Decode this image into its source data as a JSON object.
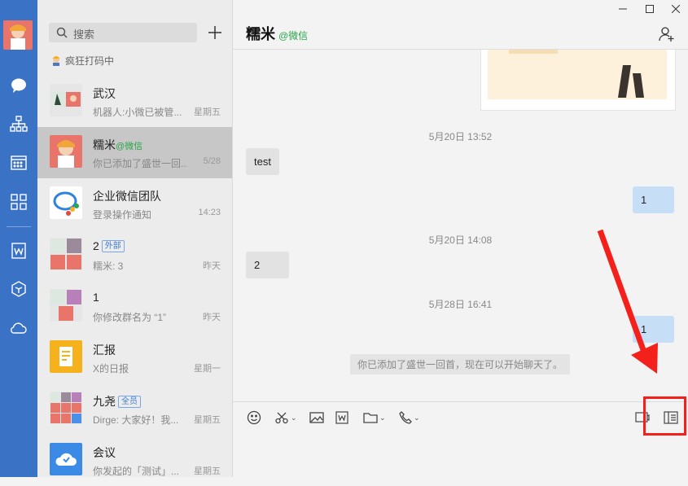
{
  "sidebar_rail": {
    "nav": [
      "chat-icon",
      "org-chart-icon",
      "calendar-icon",
      "apps-grid-icon",
      "doc-icon",
      "cube-icon",
      "cloud-icon"
    ]
  },
  "conversations_panel": {
    "search_label": "搜索",
    "status_text": "疯狂打码中",
    "items": [
      {
        "name": "武汉",
        "tag": "",
        "preview": "机器人:小微已被管...",
        "time": "星期五",
        "selected": false
      },
      {
        "name": "糯米",
        "tag": "@微信",
        "preview": "你已添加了盛世一回...",
        "time": "5/28",
        "selected": true
      },
      {
        "name": "企业微信团队",
        "tag": "",
        "preview": "登录操作通知",
        "time": "14:23",
        "selected": false
      },
      {
        "name": "2",
        "badge": "外部",
        "preview": "糯米: 3",
        "time": "昨天",
        "selected": false
      },
      {
        "name": "1",
        "tag": "",
        "preview": "你修改群名为 “1”",
        "time": "昨天",
        "selected": false
      },
      {
        "name": "汇报",
        "tag": "",
        "preview": "X的日报",
        "time": "星期一",
        "selected": false
      },
      {
        "name": "九尧",
        "badge": "全员",
        "preview": "Dirge: 大家好！我...",
        "time": "星期五",
        "selected": false
      },
      {
        "name": "会议",
        "tag": "",
        "preview": "你发起的「测试」...",
        "time": "星期五",
        "selected": false
      }
    ]
  },
  "chat": {
    "title": "糯米",
    "subtitle": "@微信",
    "messages": {
      "ts1": "5月20日 13:52",
      "m1": "test",
      "m2": "1",
      "ts2": "5月20日 14:08",
      "m3": "2",
      "ts3": "5月28日 16:41",
      "m4": "1",
      "system": "你已添加了盛世一回首，现在可以开始聊天了。"
    }
  },
  "colors": {
    "rail": "#3a72c6",
    "highlight": "#f4201c",
    "green": "#2aa54a"
  }
}
